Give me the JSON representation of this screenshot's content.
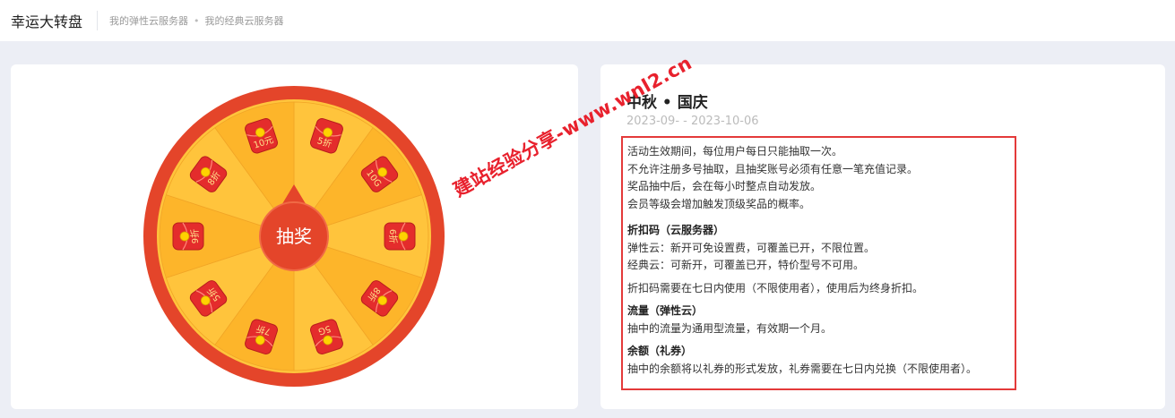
{
  "header": {
    "title": "幸运大转盘",
    "breadcrumb": [
      "我的弹性云服务器",
      "我的经典云服务器"
    ]
  },
  "wheel": {
    "button_label": "抽奖",
    "prizes": [
      "5折",
      "10G",
      "6折",
      "8折",
      "5G",
      "7折",
      "5折",
      "9折",
      "8折",
      "10元"
    ],
    "colors": {
      "rim": "#e4452a",
      "segment_light": "#ffc43c",
      "segment_dark": "#fdb52a",
      "hub": "#e4452a",
      "envelope": "#e42c2c",
      "coin": "#ffd200"
    }
  },
  "event": {
    "title": "中秋 • 国庆",
    "date_range": "2023-09-  - 2023-10-06",
    "rules": [
      "活动生效期间，每位用户每日只能抽取一次。",
      "不允许注册多号抽取，且抽奖账号必须有任意一笔充值记录。",
      "奖品抽中后，会在每小时整点自动发放。",
      "会员等级会增加触发顶级奖品的概率。"
    ],
    "discount": {
      "heading": "折扣码（云服务器）",
      "lines": [
        "弹性云：新开可免设置费，可覆盖已开，不限位置。",
        "经典云：可新开，可覆盖已开，特价型号不可用。"
      ],
      "note": "折扣码需要在七日内使用（不限使用者），使用后为终身折扣。"
    },
    "traffic": {
      "heading": "流量（弹性云）",
      "line": "抽中的流量为通用型流量，有效期一个月。"
    },
    "balance": {
      "heading": "余额（礼券）",
      "line": "抽中的余额将以礼券的形式发放，礼券需要在七日内兑换（不限使用者）。"
    }
  },
  "watermark": "建站经验分享-www.wnl2.cn"
}
